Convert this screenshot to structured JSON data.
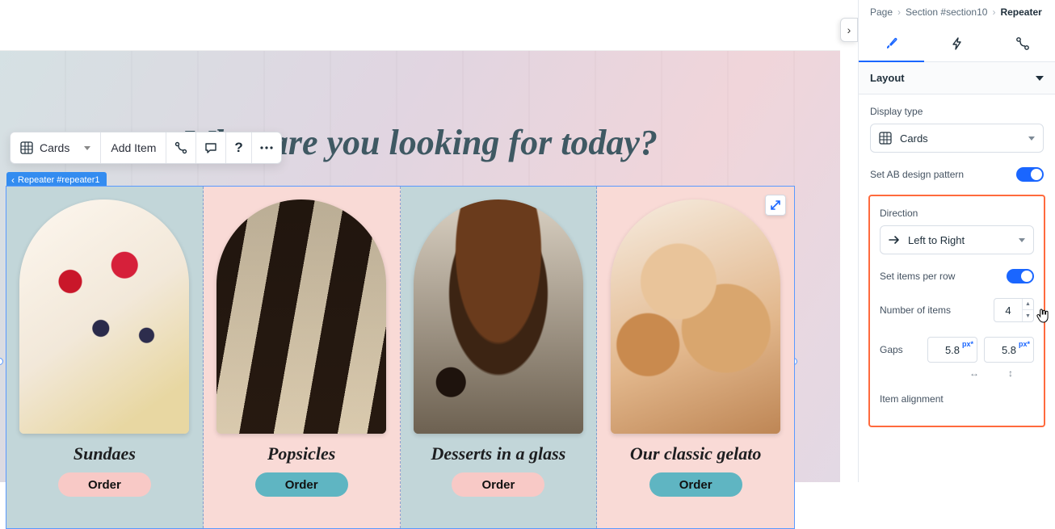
{
  "headline": "What are you looking for today?",
  "toolbar": {
    "display_mode": "Cards",
    "add_item": "Add Item"
  },
  "repeater_tag": "Repeater #repeater1",
  "cards": [
    {
      "title": "Sundaes",
      "cta": "Order"
    },
    {
      "title": "Popsicles",
      "cta": "Order"
    },
    {
      "title": "Desserts in a glass",
      "cta": "Order"
    },
    {
      "title": "Our classic gelato",
      "cta": "Order"
    }
  ],
  "breadcrumb": {
    "l0": "Page",
    "l1": "Section #section10",
    "l2": "Repeater"
  },
  "panel": {
    "section_title": "Layout",
    "display_type_label": "Display type",
    "display_type_value": "Cards",
    "ab_label": "Set AB design pattern",
    "direction_label": "Direction",
    "direction_value": "Left to Right",
    "items_per_row_label": "Set items per row",
    "num_items_label": "Number of items",
    "num_items_value": "4",
    "gaps_label": "Gaps",
    "gap_h": "5.8",
    "gap_v": "5.8",
    "gap_unit": "px*",
    "alignment_label": "Item alignment"
  }
}
